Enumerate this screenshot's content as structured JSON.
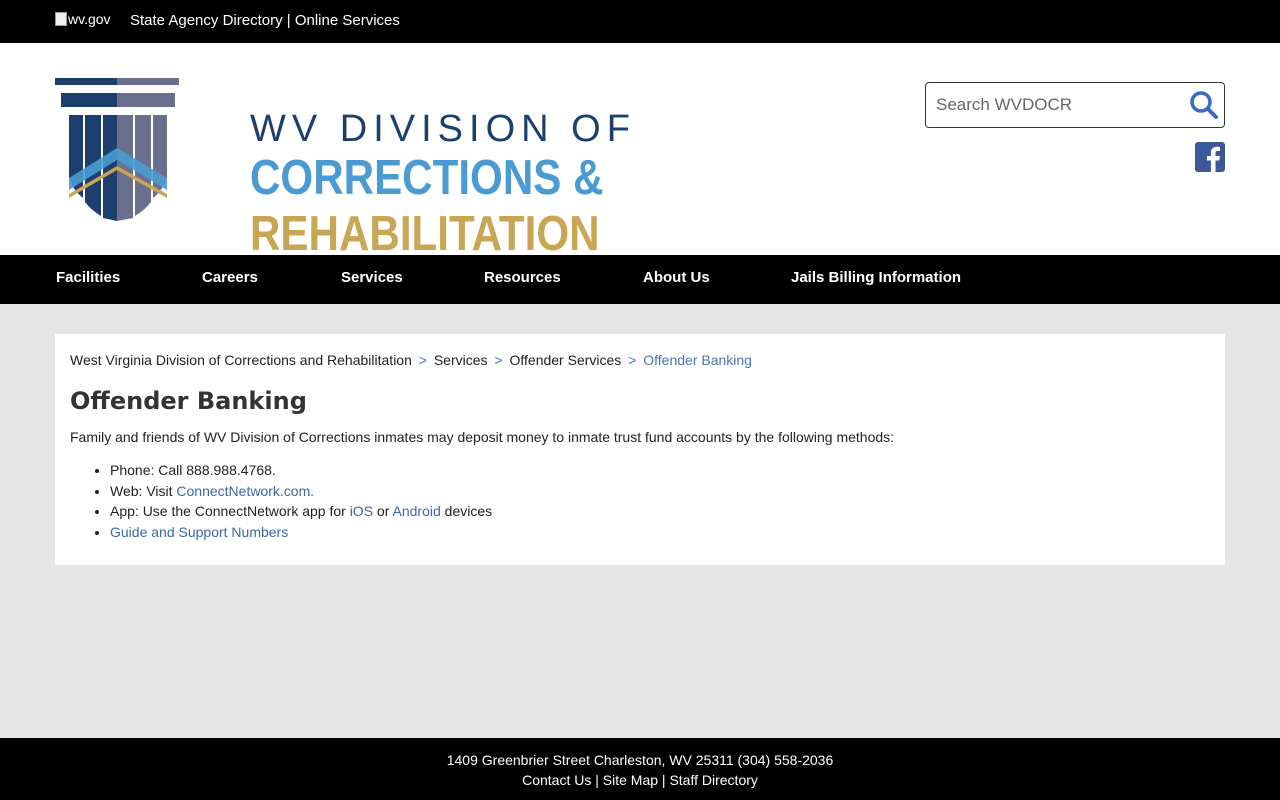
{
  "topbar": {
    "wvgov_alt": "wv.gov",
    "directory_link": "State Agency Directory",
    "separator": "|",
    "online_services_link": "Online Services"
  },
  "logo": {
    "line1": "WV DIVISION OF",
    "line2": "CORRECTIONS &",
    "line3": "REHABILITATION"
  },
  "search": {
    "placeholder": "Search WVDOCR",
    "icon": "search-icon"
  },
  "social": {
    "facebook_icon": "facebook-icon"
  },
  "nav": {
    "items": [
      "Facilities",
      "Careers",
      "Services",
      "Resources",
      "About Us",
      "Jails Billing Information"
    ]
  },
  "breadcrumb": {
    "items": [
      "West Virginia Division of Corrections and Rehabilitation",
      "Services",
      "Offender Services",
      "Offender Banking"
    ],
    "separator": ">"
  },
  "page": {
    "title": "Offender Banking",
    "intro": "Family and friends of WV Division of Corrections inmates may deposit money to inmate trust fund accounts by the following methods:",
    "methods": {
      "phone": "Phone: Call 888.988.4768.",
      "web_prefix": "Web: Visit ",
      "web_link": "ConnectNetwork.com.",
      "app_prefix": "App: Use the ConnectNetwork app for ",
      "app_ios": "iOS",
      "app_or": " or ",
      "app_android": "Android",
      "app_suffix": " devices",
      "guide_link": "Guide and Support Numbers"
    }
  },
  "footer": {
    "address": "1409 Greenbrier Street Charleston, WV 25311 (304) 558-2036",
    "links": [
      "Contact Us",
      "Site Map",
      "Staff Directory"
    ],
    "separator": "|"
  },
  "colors": {
    "navy": "#1c3f6e",
    "blue": "#4a9bd3",
    "gold": "#c8a653",
    "link": "#3868a8",
    "facebook": "#3b5998"
  }
}
